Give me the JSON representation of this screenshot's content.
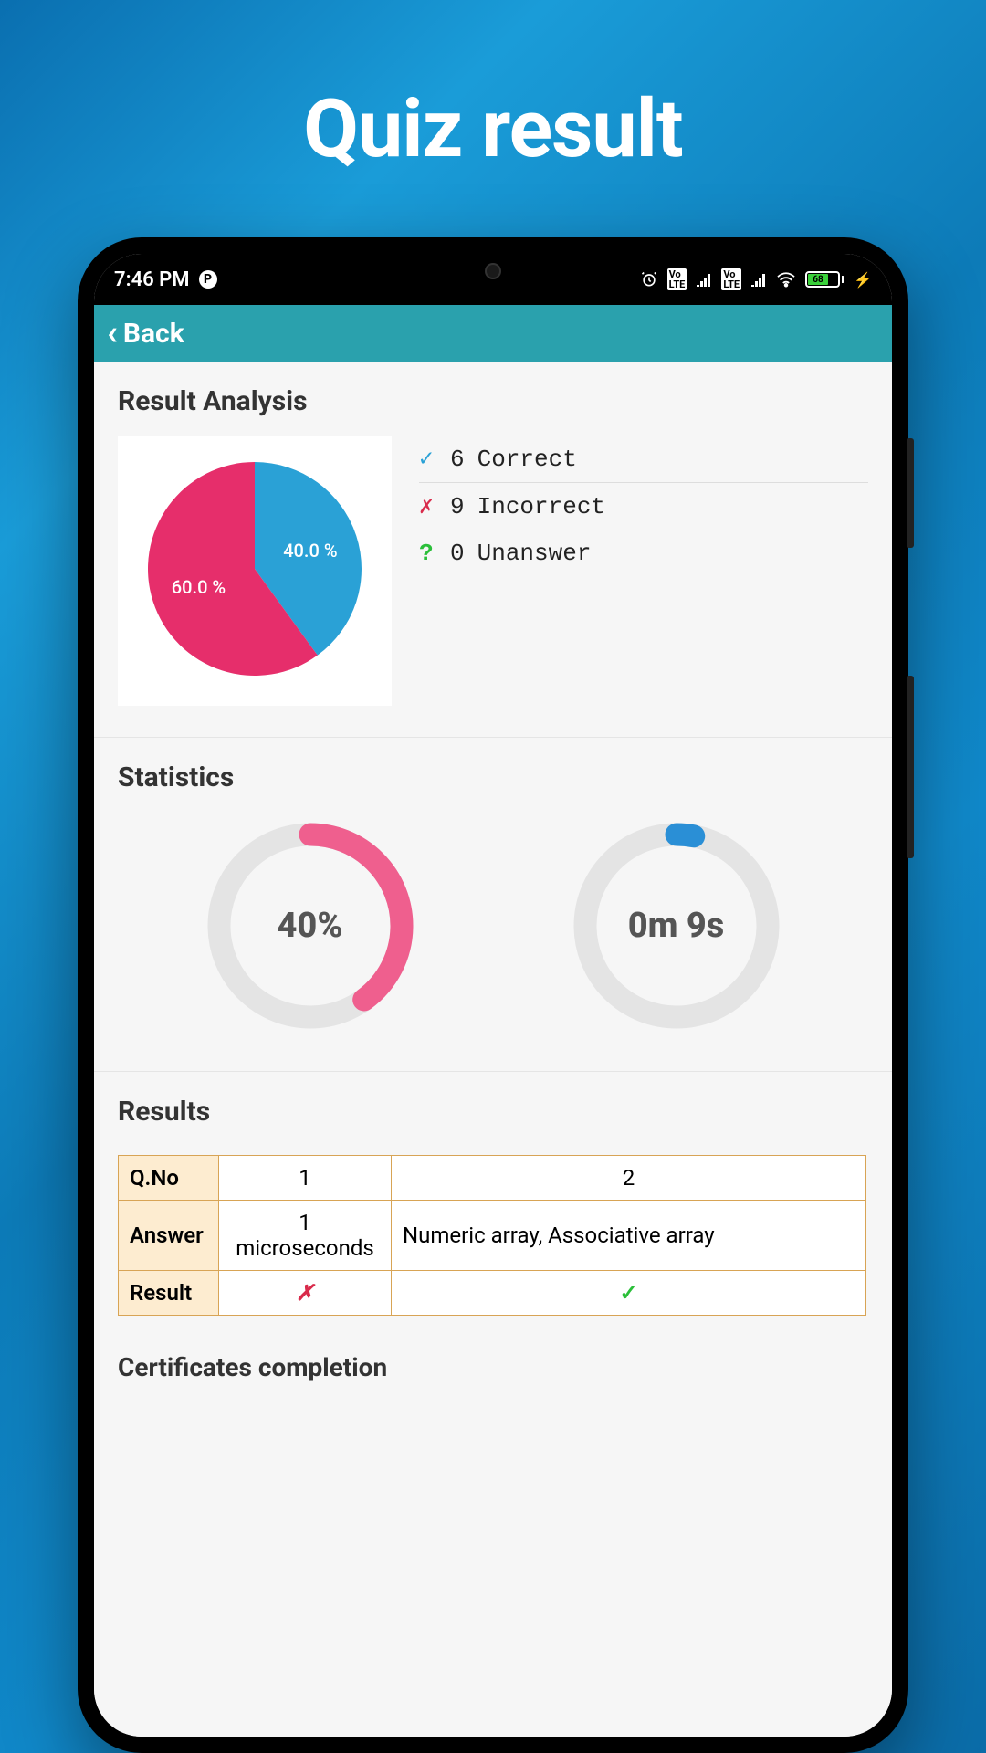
{
  "promo": {
    "title": "Quiz result"
  },
  "statusbar": {
    "time": "7:46 PM",
    "battery_pct": 68,
    "icons": {
      "p_indicator": "P",
      "volte": "Vo LTE",
      "charging": "⚡"
    }
  },
  "appbar": {
    "back_label": "Back"
  },
  "sections": {
    "analysis_title": "Result Analysis",
    "statistics_title": "Statistics",
    "results_title": "Results",
    "certificates_title": "Certificates completion"
  },
  "legend": {
    "correct": {
      "count": 6,
      "label": "Correct",
      "symbol": "✓",
      "color": "#2aa1d6"
    },
    "incorrect": {
      "count": 9,
      "label": "Incorrect",
      "symbol": "✗",
      "color": "#d92b4b"
    },
    "unanswer": {
      "count": 0,
      "label": "Unanswer",
      "symbol": "?",
      "color": "#2bbf3a"
    }
  },
  "chart_data": {
    "type": "pie",
    "title": "Result Analysis",
    "series": [
      {
        "name": "Correct",
        "value": 40.0,
        "label": "40.0 %",
        "color": "#2aa1d6"
      },
      {
        "name": "Incorrect",
        "value": 60.0,
        "label": "60.0 %",
        "color": "#e62e6b"
      }
    ]
  },
  "stats": {
    "score_pct": 40,
    "score_label": "40%",
    "time_label": "0m 9s",
    "time_fraction_pct": 3,
    "colors": {
      "score_ring": "#ef5f8e",
      "time_ring": "#2a8fd6",
      "track": "#e4e4e4"
    }
  },
  "results_table": {
    "row_headers": [
      "Q.No",
      "Answer",
      "Result"
    ],
    "columns": [
      {
        "qno": "1",
        "answer": "1 microseconds",
        "result": "x"
      },
      {
        "qno": "2",
        "answer": "Numeric array, Associative array",
        "result": "v"
      }
    ]
  }
}
